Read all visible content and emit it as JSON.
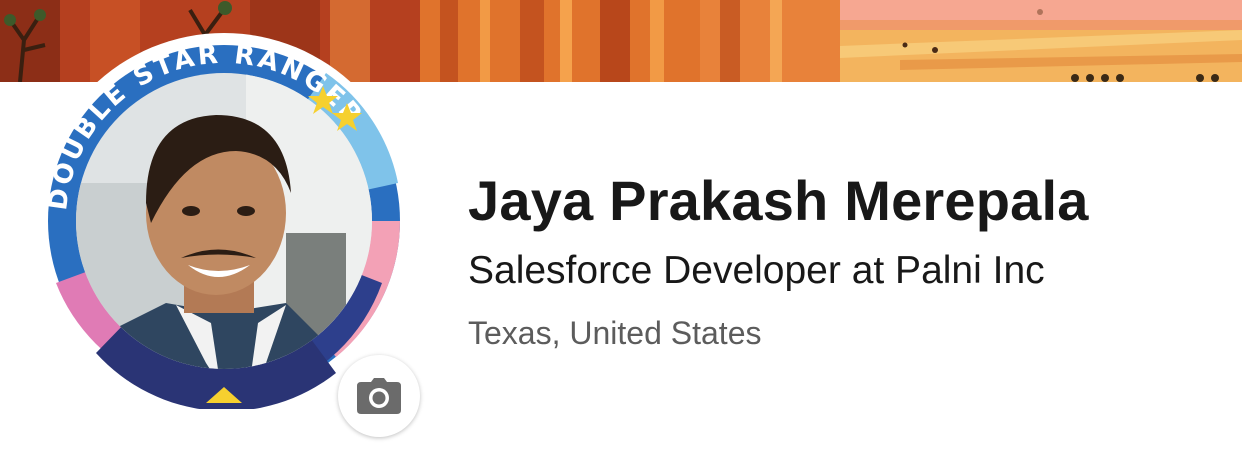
{
  "profile": {
    "name": "Jaya Prakash Merepala",
    "headline": "Salesforce Developer at Palni Inc",
    "location": "Texas, United States"
  },
  "badge": {
    "ring_text": "DOUBLE STAR RANGER",
    "star_count": 2
  },
  "icons": {
    "change_photo": "camera-icon"
  },
  "colors": {
    "banner_dark": "#b23a1c",
    "banner_orange": "#e06a2a",
    "banner_sand": "#f2b25b",
    "banner_pink": "#f7a48a",
    "ring_blue": "#2a6fc0",
    "star_yellow": "#f6d02f",
    "camera_gray": "#6b6b6b",
    "text_primary": "#181818",
    "text_secondary": "#5c5c5c"
  }
}
